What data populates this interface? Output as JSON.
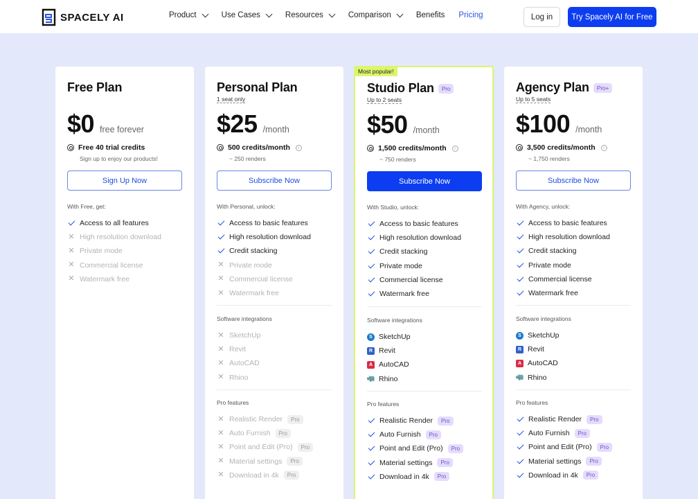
{
  "header": {
    "brand": "SPACELY AI",
    "nav": [
      {
        "label": "Product",
        "dropdown": true
      },
      {
        "label": "Use Cases",
        "dropdown": true
      },
      {
        "label": "Resources",
        "dropdown": true
      },
      {
        "label": "Comparison",
        "dropdown": true
      },
      {
        "label": "Benefits",
        "dropdown": false
      },
      {
        "label": "Pricing",
        "dropdown": false,
        "active": true
      }
    ],
    "login_label": "Log in",
    "try_label": "Try Spacely AI for Free"
  },
  "colors": {
    "accent": "#0d3df0",
    "popular": "#dcf56c",
    "background": "#e3e8fa"
  },
  "plans": [
    {
      "name": "Free Plan",
      "price": "$0",
      "period": "free forever",
      "credits": "Free 40 trial credits",
      "credits_sub": "Sign up to enjoy our products!",
      "cta": "Sign Up Now",
      "unlock_label": "With Free, get:",
      "features": [
        {
          "label": "Access to all features",
          "included": true
        },
        {
          "label": "High resolution download",
          "included": false
        },
        {
          "label": "Private mode",
          "included": false
        },
        {
          "label": "Commercial license",
          "included": false
        },
        {
          "label": "Watermark free",
          "included": false
        }
      ]
    },
    {
      "name": "Personal Plan",
      "seats": "1 seat only",
      "price": "$25",
      "period": "/month",
      "credits": "500 credits/month",
      "credits_sub": "~ 250 renders",
      "cta": "Subscribe Now",
      "unlock_label": "With Personal, unlock:",
      "features": [
        {
          "label": "Access to basic features",
          "included": true
        },
        {
          "label": "High resolution download",
          "included": true
        },
        {
          "label": "Credit stacking",
          "included": true
        },
        {
          "label": "Private mode",
          "included": false
        },
        {
          "label": "Commercial license",
          "included": false
        },
        {
          "label": "Watermark free",
          "included": false
        }
      ],
      "integrations_label": "Software integrations",
      "integrations": [
        {
          "label": "SketchUp",
          "included": false
        },
        {
          "label": "Revit",
          "included": false
        },
        {
          "label": "AutoCAD",
          "included": false
        },
        {
          "label": "Rhino",
          "included": false
        }
      ],
      "pro_label": "Pro features",
      "pro_features": [
        {
          "label": "Realistic Render",
          "included": false,
          "badge": "Pro"
        },
        {
          "label": "Auto Furnish",
          "included": false,
          "badge": "Pro"
        },
        {
          "label": "Point and Edit (Pro)",
          "included": false,
          "badge": "Pro"
        },
        {
          "label": "Material settings",
          "included": false,
          "badge": "Pro"
        },
        {
          "label": "Download in 4k",
          "included": false,
          "badge": "Pro"
        }
      ]
    },
    {
      "name": "Studio Plan",
      "badge": "Pro",
      "popular_label": "Most popular!",
      "seats": "Up to 2 seats",
      "price": "$50",
      "period": "/month",
      "credits": "1,500 credits/month",
      "credits_sub": "~ 750 renders",
      "cta": "Subscribe Now",
      "unlock_label": "With Studio, unlock:",
      "features": [
        {
          "label": "Access to basic features",
          "included": true
        },
        {
          "label": "High resolution download",
          "included": true
        },
        {
          "label": "Credit stacking",
          "included": true
        },
        {
          "label": "Private mode",
          "included": true
        },
        {
          "label": "Commercial license",
          "included": true
        },
        {
          "label": "Watermark free",
          "included": true
        }
      ],
      "integrations_label": "Software integrations",
      "integrations": [
        {
          "label": "SketchUp",
          "included": true,
          "icon": "sketchup-icon"
        },
        {
          "label": "Revit",
          "included": true,
          "icon": "revit-icon"
        },
        {
          "label": "AutoCAD",
          "included": true,
          "icon": "autocad-icon"
        },
        {
          "label": "Rhino",
          "included": true,
          "icon": "rhino-icon"
        }
      ],
      "pro_label": "Pro features",
      "pro_features": [
        {
          "label": "Realistic Render",
          "included": true,
          "badge": "Pro"
        },
        {
          "label": "Auto Furnish",
          "included": true,
          "badge": "Pro"
        },
        {
          "label": "Point and Edit (Pro)",
          "included": true,
          "badge": "Pro"
        },
        {
          "label": "Material settings",
          "included": true,
          "badge": "Pro"
        },
        {
          "label": "Download in 4k",
          "included": true,
          "badge": "Pro"
        }
      ]
    },
    {
      "name": "Agency Plan",
      "badge": "Pro+",
      "seats": "Up to 5 seats",
      "price": "$100",
      "period": "/month",
      "credits": "3,500 credits/month",
      "credits_sub": "~ 1,750 renders",
      "cta": "Subscribe Now",
      "unlock_label": "With Agency, unlock:",
      "features": [
        {
          "label": "Access to basic features",
          "included": true
        },
        {
          "label": "High resolution download",
          "included": true
        },
        {
          "label": "Credit stacking",
          "included": true
        },
        {
          "label": "Private mode",
          "included": true
        },
        {
          "label": "Commercial license",
          "included": true
        },
        {
          "label": "Watermark free",
          "included": true
        }
      ],
      "integrations_label": "Software integrations",
      "integrations": [
        {
          "label": "SketchUp",
          "included": true,
          "icon": "sketchup-icon"
        },
        {
          "label": "Revit",
          "included": true,
          "icon": "revit-icon"
        },
        {
          "label": "AutoCAD",
          "included": true,
          "icon": "autocad-icon"
        },
        {
          "label": "Rhino",
          "included": true,
          "icon": "rhino-icon"
        }
      ],
      "pro_label": "Pro features",
      "pro_features": [
        {
          "label": "Realistic Render",
          "included": true,
          "badge": "Pro"
        },
        {
          "label": "Auto Furnish",
          "included": true,
          "badge": "Pro"
        },
        {
          "label": "Point and Edit (Pro)",
          "included": true,
          "badge": "Pro"
        },
        {
          "label": "Material settings",
          "included": true,
          "badge": "Pro"
        },
        {
          "label": "Download in 4k",
          "included": true,
          "badge": "Pro"
        }
      ]
    }
  ]
}
